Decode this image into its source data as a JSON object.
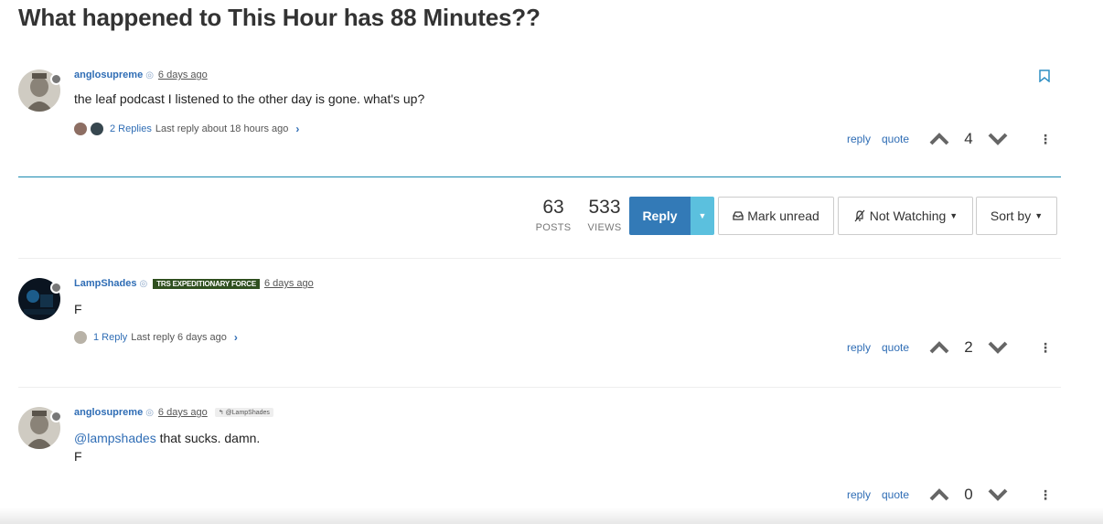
{
  "topic": {
    "title": "What happened to This Hour has 88 Minutes??",
    "posts_count": "63",
    "posts_label": "POSTS",
    "views_count": "533",
    "views_label": "VIEWS"
  },
  "toolbar": {
    "reply_label": "Reply",
    "mark_unread_label": "Mark unread",
    "watching_label": "Not Watching",
    "sort_label": "Sort by"
  },
  "action_labels": {
    "reply": "reply",
    "quote": "quote"
  },
  "posts": [
    {
      "author": "anglosupreme",
      "timestamp": "6 days ago",
      "content": "the leaf podcast I listened to the other day is gone. what's up?",
      "replies_count": "2 Replies",
      "last_reply": "Last reply about 18 hours ago",
      "votes": "4"
    },
    {
      "author": "LampShades",
      "badge": "TRS EXPEDITIONARY FORCE",
      "timestamp": "6 days ago",
      "content": "F",
      "replies_count": "1 Reply",
      "last_reply": "Last reply 6 days ago",
      "votes": "2"
    },
    {
      "author": "anglosupreme",
      "timestamp": "6 days ago",
      "reply_to": "@LampShades",
      "mention": "@lampshades",
      "content": " that sucks. damn.",
      "content_line2": "F",
      "votes": "0"
    }
  ],
  "colors": {
    "link": "#2f6db5",
    "primary": "#337ab7",
    "info": "#5bc0de",
    "divider": "#1a8ab0",
    "badge": "#2f4f1f"
  }
}
